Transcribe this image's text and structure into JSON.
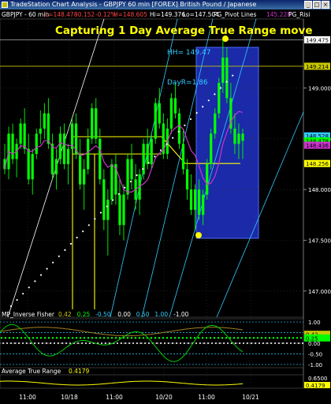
{
  "window": {
    "title": "TradeStation Chart Analysis - GBPJPY 60 min [FOREX] British Pound / Japanese"
  },
  "status": {
    "symbol": "GBPJPY - 60 min",
    "last": "L=148.478",
    "change": "-0.152",
    "pct": "-0.12%",
    "open": "H=148.605",
    "high": "Hi=149.376",
    "low": "Lo=147.504",
    "pivot_label": "PG_Pivot Lines",
    "pivot_value": "145.228",
    "risk_label": "PG_Risi"
  },
  "annotations": {
    "headline": "Capturing 1 Day Average True Range move",
    "hh_label": "HH= 149.47",
    "dayr_label": "DayR=1.86"
  },
  "price_axis": {
    "ticks": [
      "149.000",
      "148.500",
      "148.000",
      "147.500",
      "147.000"
    ],
    "boxes": [
      {
        "text": "149.475",
        "bg": "#ffffff",
        "fg": "#000000",
        "value": 149.475
      },
      {
        "text": "149.214",
        "bg": "#c8c800",
        "fg": "#000000",
        "value": 149.214
      },
      {
        "text": "148.528",
        "bg": "#33ccff",
        "fg": "#000000",
        "value": 148.528
      },
      {
        "text": "148.478",
        "bg": "#00ff00",
        "fg": "#000000",
        "value": 148.478
      },
      {
        "text": "148.436",
        "bg": "#cc33cc",
        "fg": "#000000",
        "value": 148.436
      },
      {
        "text": "148.256",
        "bg": "#ffff00",
        "fg": "#000000",
        "value": 148.256
      }
    ]
  },
  "time_axis": {
    "labels": [
      "11:00",
      "10/18",
      "11:00",
      "10/20",
      "11:00",
      "10/21"
    ]
  },
  "fisher": {
    "name": "MP_Inverse Fisher",
    "values": [
      "0.42",
      "0.25",
      "-0.50",
      "0.00",
      "0.50",
      "1.00",
      "-1.00"
    ],
    "colors": [
      "#c8c800",
      "#00ff00",
      "#33ccff",
      "#ffffff",
      "#33ccff",
      "#33ccff",
      "#ffffff"
    ],
    "axis_ticks": [
      "1.00",
      "0.50",
      "0.00",
      "-0.50",
      "-1.00"
    ],
    "axis_boxes": [
      {
        "text": "0.42",
        "bg": "#c8c800",
        "value": 0.42
      },
      {
        "text": "0.25",
        "bg": "#00ff00",
        "value": 0.25
      }
    ]
  },
  "atr": {
    "name": "Average True Range",
    "value": "0.4179",
    "axis_ticks": [
      "0.6500"
    ],
    "axis_box": {
      "text": "0.4179",
      "bg": "#ffff00"
    }
  },
  "chart_data": {
    "type": "candlestick",
    "title": "Capturing 1 Day Average True Range move",
    "ylim": [
      146.82,
      149.68
    ],
    "x_labels": [
      "11:00",
      "10/18",
      "11:00",
      "10/20",
      "11:00",
      "10/21"
    ],
    "candles": [
      [
        148.3,
        148.45,
        148.15,
        148.2
      ],
      [
        148.2,
        148.62,
        148.1,
        148.55
      ],
      [
        148.55,
        148.65,
        148.25,
        148.3
      ],
      [
        148.3,
        148.5,
        148.12,
        148.45
      ],
      [
        148.45,
        148.7,
        148.4,
        148.65
      ],
      [
        148.65,
        148.8,
        148.35,
        148.4
      ],
      [
        148.4,
        148.55,
        148.05,
        148.1
      ],
      [
        148.1,
        148.4,
        147.95,
        148.35
      ],
      [
        148.35,
        148.6,
        148.3,
        148.55
      ],
      [
        148.55,
        148.78,
        148.45,
        148.6
      ],
      [
        148.6,
        148.85,
        148.5,
        148.75
      ],
      [
        148.75,
        148.9,
        148.4,
        148.45
      ],
      [
        148.45,
        148.55,
        148.1,
        148.15
      ],
      [
        148.15,
        148.4,
        148.0,
        148.3
      ],
      [
        148.3,
        148.62,
        148.25,
        148.55
      ],
      [
        148.55,
        148.65,
        148.2,
        148.25
      ],
      [
        148.25,
        148.45,
        148.05,
        148.4
      ],
      [
        148.4,
        148.7,
        148.35,
        148.65
      ],
      [
        148.65,
        148.75,
        148.3,
        148.35
      ],
      [
        148.35,
        148.5,
        148.0,
        148.05
      ],
      [
        148.05,
        148.3,
        147.8,
        148.2
      ],
      [
        148.2,
        148.6,
        148.15,
        148.5
      ],
      [
        148.5,
        148.85,
        148.45,
        148.8
      ],
      [
        148.8,
        148.9,
        148.45,
        148.5
      ],
      [
        148.5,
        148.6,
        148.05,
        148.1
      ],
      [
        148.1,
        148.2,
        147.6,
        147.7
      ],
      [
        147.7,
        148.0,
        147.35,
        147.9
      ],
      [
        147.9,
        148.3,
        147.85,
        148.25
      ],
      [
        148.25,
        148.35,
        147.85,
        147.95
      ],
      [
        147.95,
        148.1,
        147.55,
        147.65
      ],
      [
        147.65,
        148.05,
        147.5,
        147.95
      ],
      [
        147.95,
        148.35,
        147.9,
        148.3
      ],
      [
        148.3,
        148.45,
        148.0,
        148.1
      ],
      [
        148.1,
        148.25,
        147.8,
        147.9
      ],
      [
        147.9,
        148.2,
        147.75,
        148.15
      ],
      [
        148.15,
        148.5,
        148.1,
        148.45
      ],
      [
        148.45,
        148.6,
        148.2,
        148.25
      ],
      [
        148.25,
        148.55,
        148.2,
        148.5
      ],
      [
        148.5,
        148.9,
        148.45,
        148.85
      ],
      [
        148.85,
        149.0,
        148.6,
        148.65
      ],
      [
        148.65,
        148.75,
        148.3,
        148.35
      ],
      [
        148.35,
        148.7,
        148.3,
        148.6
      ],
      [
        148.6,
        148.95,
        148.55,
        148.9
      ],
      [
        148.9,
        149.05,
        148.7,
        148.75
      ],
      [
        148.75,
        148.8,
        148.4,
        148.45
      ],
      [
        148.45,
        148.6,
        148.15,
        148.2
      ],
      [
        148.2,
        148.3,
        147.9,
        148.0
      ],
      [
        148.0,
        148.15,
        147.75,
        147.8
      ],
      [
        147.8,
        148.05,
        147.6,
        148.0
      ],
      [
        148.0,
        148.1,
        147.7,
        147.75
      ],
      [
        147.75,
        148.0,
        147.65,
        147.95
      ],
      [
        147.95,
        148.3,
        147.9,
        148.25
      ],
      [
        148.25,
        148.6,
        148.2,
        148.55
      ],
      [
        148.55,
        148.8,
        148.5,
        148.75
      ],
      [
        148.75,
        149.1,
        148.7,
        149.05
      ],
      [
        149.05,
        149.47,
        148.95,
        149.3
      ],
      [
        149.3,
        149.4,
        148.85,
        148.9
      ],
      [
        148.9,
        149.05,
        148.55,
        148.6
      ],
      [
        148.6,
        148.75,
        148.35,
        148.45
      ],
      [
        148.45,
        148.65,
        148.3,
        148.55
      ],
      [
        148.55,
        148.6,
        148.3,
        148.48
      ]
    ]
  }
}
